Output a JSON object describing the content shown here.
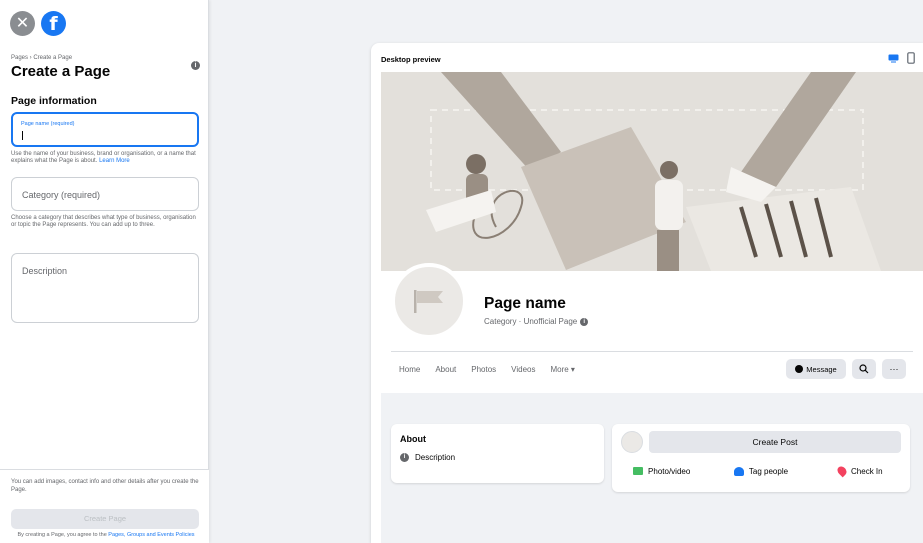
{
  "left": {
    "breadcrumb": "Pages › Create a Page",
    "title": "Create a Page",
    "section_heading": "Page information",
    "page_name_label": "Page name (required)",
    "page_name_help": "Use the name of your business, brand or organisation, or a name that explains what the Page is about.",
    "learn_more": "Learn More",
    "category_placeholder": "Category (required)",
    "category_help": "Choose a category that describes what type of business, organisation or topic the Page represents. You can add up to three.",
    "description_placeholder": "Description",
    "footnote": "You can add images, contact info and other details after you create the Page.",
    "create_button": "Create Page",
    "terms_prefix": "By creating a Page, you agree to the",
    "terms_link": "Pages, Groups and Events Policies"
  },
  "preview": {
    "title": "Desktop preview",
    "page_name": "Page name",
    "category": "Category · Unofficial Page",
    "tabs": [
      "Home",
      "About",
      "Photos",
      "Videos",
      "More ▾"
    ],
    "message_button": "Message",
    "about_title": "About",
    "about_description": "Description",
    "create_post": "Create Post",
    "actions": [
      "Photo/video",
      "Tag people",
      "Check In"
    ]
  },
  "colors": {
    "accent": "#1877f2",
    "photo": "#45bd62",
    "checkin": "#f3425f"
  },
  "icons": [
    "close-icon",
    "facebook-logo-icon",
    "info-icon",
    "desktop-icon",
    "mobile-icon",
    "flag-icon",
    "messenger-icon",
    "search-icon",
    "more-icon",
    "photo-icon",
    "tag-people-icon",
    "check-in-icon"
  ]
}
